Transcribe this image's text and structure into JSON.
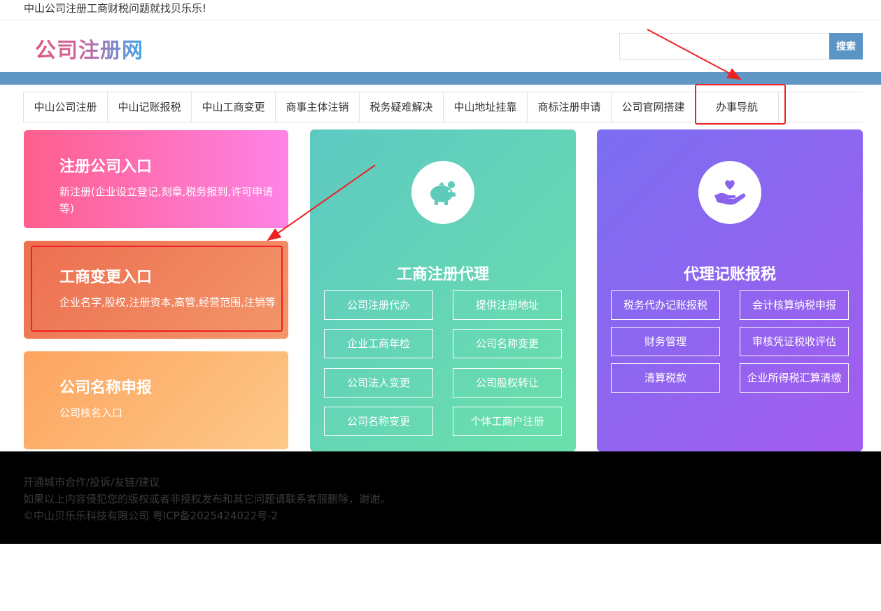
{
  "topbar": {
    "slogan": "中山公司注册工商财税问题就找贝乐乐!"
  },
  "header": {
    "logo": "公司注册网",
    "search_placeholder": "",
    "search_button": "搜索"
  },
  "nav": {
    "items": [
      {
        "label": "中山公司注册"
      },
      {
        "label": "中山记账报税"
      },
      {
        "label": "中山工商变更"
      },
      {
        "label": "商事主体注销"
      },
      {
        "label": "税务疑难解决"
      },
      {
        "label": "中山地址挂靠"
      },
      {
        "label": "商标注册申请"
      },
      {
        "label": "公司官网搭建"
      },
      {
        "label": "办事导航"
      }
    ]
  },
  "cards": {
    "register": {
      "title": "注册公司入口",
      "desc": "新注册(企业设立登记,刻章,税务报到,许可申请等)"
    },
    "change": {
      "title": "工商变更入口",
      "desc": "企业名字,股权,注册资本,高管,经营范围,注销等"
    },
    "name": {
      "title": "公司名称申报",
      "desc": "公司核名入口"
    }
  },
  "agency": {
    "title": "工商注册代理",
    "icon": "piggy-bank-icon",
    "services": [
      "公司注册代办",
      "提供注册地址",
      "企业工商年检",
      "公司名称变更",
      "公司法人变更",
      "公司股权转让",
      "公司名称变更",
      "个体工商户注册"
    ]
  },
  "bookkeeping": {
    "title": "代理记账报税",
    "icon": "hand-heart-icon",
    "services": [
      "税务代办记账报税",
      "会计核算纳税申报",
      "财务管理",
      "审核凭证税收评估",
      "清算税款",
      "企业所得税汇算清缴"
    ]
  },
  "footer": {
    "line1": "开通城市合作/投诉/友链/建议",
    "line2": "如果以上内容侵犯您的版权或者非授权发布和其它问题请联系客服删除，谢谢。",
    "line3": "©中山贝乐乐科技有限公司 粤ICP备2025424022号-2"
  },
  "colors": {
    "nav_strip": "#5f96c4",
    "search_button": "#5b95c6",
    "annotation": "#ee2222",
    "footer_bg": "#000000"
  }
}
